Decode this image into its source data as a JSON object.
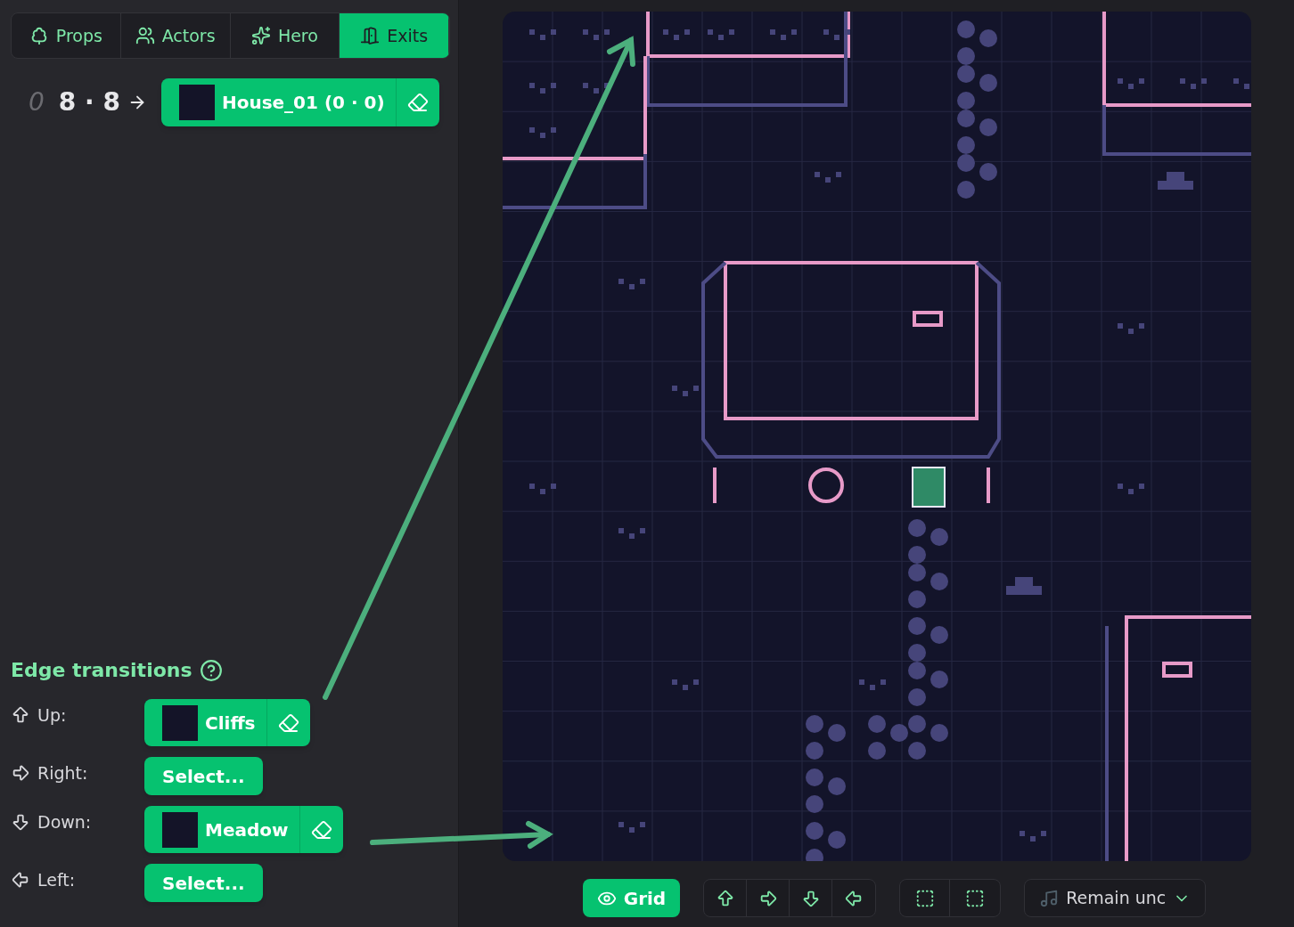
{
  "tabs": [
    {
      "label": "Props",
      "selected": false
    },
    {
      "label": "Actors",
      "selected": false
    },
    {
      "label": "Hero",
      "selected": false
    },
    {
      "label": "Exits",
      "selected": true
    }
  ],
  "exit": {
    "index": "0",
    "position": "8 · 8",
    "destination": "House_01 (0 · 0)"
  },
  "edge_transitions": {
    "title": "Edge transitions",
    "edges": [
      {
        "label": "Up:",
        "kind": "linked",
        "target": "Cliffs"
      },
      {
        "label": "Right:",
        "kind": "empty",
        "target": "Select..."
      },
      {
        "label": "Down:",
        "kind": "linked",
        "target": "Meadow"
      },
      {
        "label": "Left:",
        "kind": "empty",
        "target": "Select..."
      }
    ]
  },
  "toolbar": {
    "grid": {
      "label": "Grid",
      "on": true
    },
    "music": {
      "label": "Remain unc"
    }
  }
}
